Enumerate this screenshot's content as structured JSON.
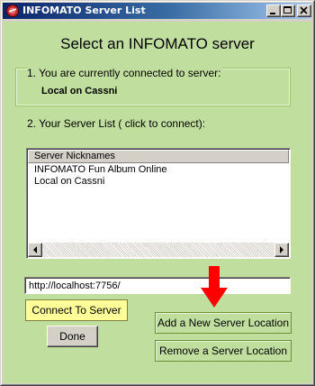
{
  "window": {
    "title": "INFOMATO Server List",
    "buttons": [
      "minimize",
      "maximize",
      "close"
    ],
    "client_background": "#c0df9f",
    "titlebar_color": "#0a246a"
  },
  "heading": "Select an INFOMATO server",
  "connection": {
    "label": "1. You are currently connected to server:",
    "current_server": "Local on Cassni"
  },
  "server_list": {
    "label": "2. Your Server List ( click to connect):",
    "column_header": "Server Nicknames",
    "items": [
      "INFOMATO Fun Album Online",
      "Local on Cassni"
    ]
  },
  "url_field": {
    "value": "http://localhost:7756/"
  },
  "buttons": {
    "connect": "Connect To Server",
    "done": "Done",
    "add": "Add a New Server Location",
    "remove": "Remove a Server Location"
  },
  "colors": {
    "connect_button": "#ffff99",
    "arrow": "#ff0000"
  },
  "icons": {
    "app": "infomato-app-icon",
    "arrow": "red-down-arrow"
  }
}
